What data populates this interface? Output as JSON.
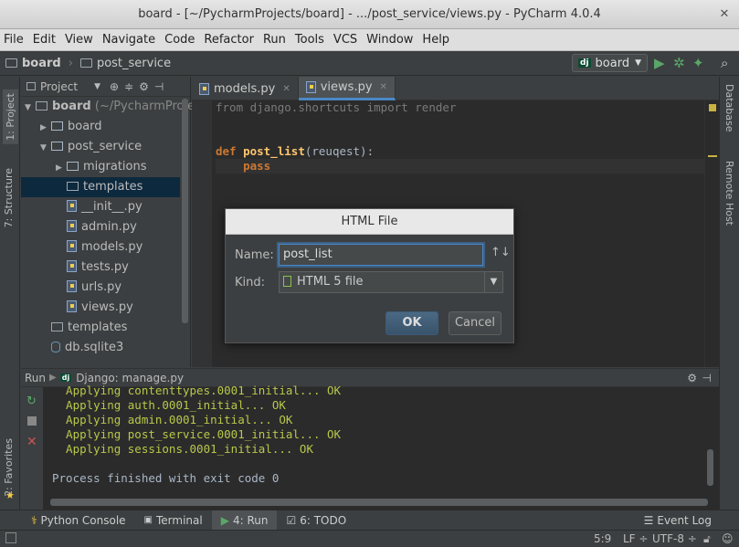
{
  "window": {
    "title": "board - [~/PycharmProjects/board] - .../post_service/views.py - PyCharm 4.0.4",
    "close": "✕"
  },
  "menu": [
    "File",
    "Edit",
    "View",
    "Navigate",
    "Code",
    "Refactor",
    "Run",
    "Tools",
    "VCS",
    "Window",
    "Help"
  ],
  "navbar": {
    "crumb1": "board",
    "crumb2": "post_service",
    "run_config": "board",
    "dj": "dj"
  },
  "left_strip": {
    "project_tab": "1: Project",
    "structure_tab": "7: Structure",
    "favorites_tab": "2: Favorites"
  },
  "right_strip": {
    "database_tab": "Database",
    "remote_tab": "Remote Host"
  },
  "project_panel": {
    "title": "Project",
    "tree": [
      {
        "label": "board",
        "extra": " (~/PycharmProjec",
        "indent": 0,
        "arrow": "▼",
        "icon": "folder"
      },
      {
        "label": "board",
        "extra": "",
        "indent": 1,
        "arrow": "▶",
        "icon": "package"
      },
      {
        "label": "post_service",
        "extra": "",
        "indent": 1,
        "arrow": "▼",
        "icon": "package"
      },
      {
        "label": "migrations",
        "extra": "",
        "indent": 2,
        "arrow": "▶",
        "icon": "package"
      },
      {
        "label": "templates",
        "extra": "",
        "indent": 2,
        "arrow": "",
        "icon": "folder",
        "selected": true
      },
      {
        "label": "__init__.py",
        "extra": "",
        "indent": 2,
        "arrow": "",
        "icon": "py"
      },
      {
        "label": "admin.py",
        "extra": "",
        "indent": 2,
        "arrow": "",
        "icon": "py"
      },
      {
        "label": "models.py",
        "extra": "",
        "indent": 2,
        "arrow": "",
        "icon": "py"
      },
      {
        "label": "tests.py",
        "extra": "",
        "indent": 2,
        "arrow": "",
        "icon": "py"
      },
      {
        "label": "urls.py",
        "extra": "",
        "indent": 2,
        "arrow": "",
        "icon": "py"
      },
      {
        "label": "views.py",
        "extra": "",
        "indent": 2,
        "arrow": "",
        "icon": "py"
      },
      {
        "label": "templates",
        "extra": "",
        "indent": 1,
        "arrow": "",
        "icon": "folder"
      },
      {
        "label": "db.sqlite3",
        "extra": "",
        "indent": 1,
        "arrow": "",
        "icon": "db"
      }
    ]
  },
  "editor": {
    "tabs": [
      {
        "label": "models.py"
      },
      {
        "label": "views.py",
        "active": true
      }
    ],
    "line1_from": "from ",
    "line1_mod": "django.shortcuts ",
    "line1_import": "import ",
    "line1_name": "render",
    "line3_def": "def ",
    "line3_fn": "post_list",
    "line3_arg": "(reuqest):",
    "line4": "    pass"
  },
  "dialog": {
    "title": "HTML File",
    "name_label": "Name:",
    "name_value": "post_list",
    "kind_label": "Kind:",
    "kind_value": "HTML 5 file",
    "ok": "OK",
    "cancel": "Cancel",
    "sort_icon": "↑↓"
  },
  "run_panel": {
    "label": "Run",
    "config": "Django: manage.py",
    "lines": [
      "  Applying contenttypes.0001_initial... OK",
      "  Applying auth.0001_initial... OK",
      "  Applying admin.0001_initial... OK",
      "  Applying post_service.0001_initial... OK",
      "  Applying sessions.0001_initial... OK"
    ],
    "finished": "Process finished with exit code 0"
  },
  "bottom_tabs": {
    "python_console": "Python Console",
    "terminal": "Terminal",
    "run": "4: Run",
    "todo": "6: TODO",
    "event_log": "Event Log"
  },
  "status": {
    "position": "5:9",
    "line_sep": "LF ÷",
    "encoding": "UTF-8 ÷"
  }
}
